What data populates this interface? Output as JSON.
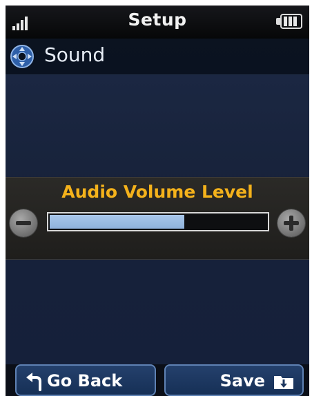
{
  "statusbar": {
    "title": "Setup",
    "icons": [
      "signal-icon",
      "battery-icon"
    ]
  },
  "subheader": {
    "title": "Sound",
    "icon": "nav-dpad-icon"
  },
  "volume": {
    "label": "Audio Volume Level",
    "level_fraction": 0.62
  },
  "softkeys": {
    "back_label": "Go Back",
    "save_label": "Save"
  },
  "colors": {
    "accent_label": "#f4b21b",
    "slider_fill": "#a9c7ea",
    "softkey_bg": "#1c3760"
  }
}
